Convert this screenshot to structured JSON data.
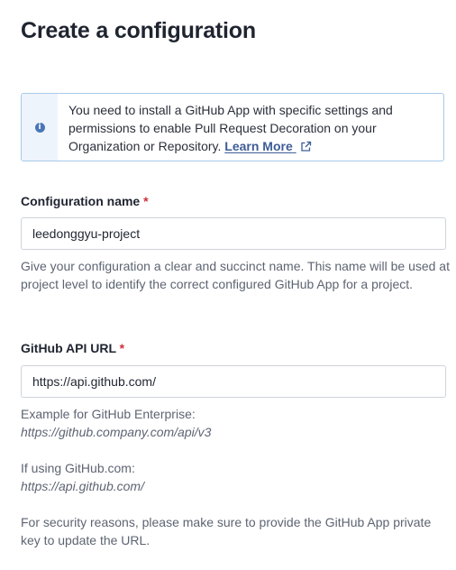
{
  "page": {
    "title": "Create a configuration"
  },
  "notice": {
    "icon": "info-icon",
    "text": "You need to install a GitHub App with specific settings and permissions to enable Pull Request Decoration on your Organization or Repository.",
    "link_label": "Learn More",
    "link_icon": "external-link-icon"
  },
  "config_name": {
    "label": "Configuration name",
    "required_mark": "*",
    "value": "leedonggyu-project",
    "help": "Give your configuration a clear and succinct name. This name will be used at project level to identify the correct configured GitHub App for a project."
  },
  "api_url": {
    "label": "GitHub API URL",
    "required_mark": "*",
    "value": "https://api.github.com/",
    "help_enterprise_label": "Example for GitHub Enterprise:",
    "help_enterprise_example": "https://github.company.com/api/v3",
    "help_github_label": "If using GitHub.com:",
    "help_github_example": "https://api.github.com/",
    "help_security": "For security reasons, please make sure to provide the GitHub App private key to update the URL."
  },
  "colors": {
    "required": "#d02f3a",
    "link": "#3e5d96",
    "notice_border": "#a9c9ea",
    "notice_side": "#eef4fb"
  }
}
